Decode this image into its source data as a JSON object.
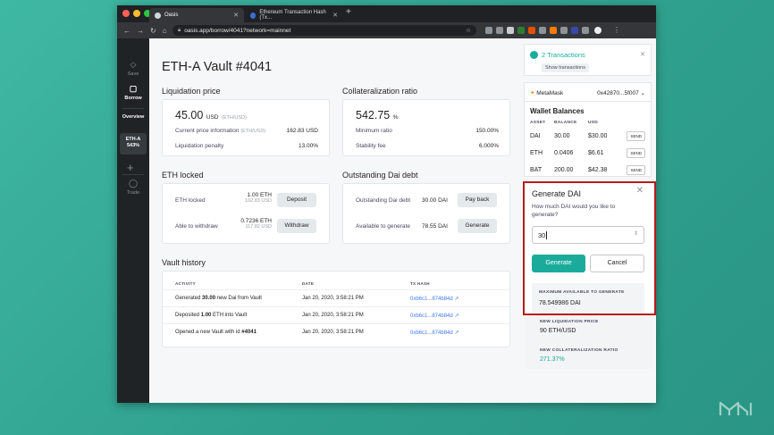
{
  "browser": {
    "tabs": [
      {
        "title": "Oasis",
        "active": true
      },
      {
        "title": "Ethereum Transaction Hash (Tx..."
      }
    ],
    "url": "oasis.app/borrow/4041?network=mainnet"
  },
  "sidebar": {
    "save": "Save",
    "borrow": "Borrow",
    "overview": "Overview",
    "vault_name": "ETH-A",
    "vault_ratio": "543%",
    "trade": "Trade"
  },
  "vault": {
    "title": "ETH-A Vault #4041",
    "liquidation": {
      "heading": "Liquidation price",
      "value": "45.00",
      "unit": "USD",
      "pair": "(ETH/USD)",
      "current_label": "Current price information",
      "current_pair": "(ETH/USD)",
      "current_value": "162.83 USD",
      "penalty_label": "Liquidation penalty",
      "penalty_value": "13.00%"
    },
    "collateral": {
      "heading": "Collateralization ratio",
      "value": "542.75",
      "unit": "%",
      "min_label": "Minimum ratio",
      "min_value": "150.00%",
      "fee_label": "Stability fee",
      "fee_value": "6.000%"
    },
    "eth_locked": {
      "heading": "ETH locked",
      "locked_label": "ETH locked",
      "locked_value": "1.00 ETH",
      "locked_usd": "162.83 USD",
      "deposit_label": "Deposit",
      "withdraw_label_row": "Able to withdraw",
      "withdraw_value": "0.7236 ETH",
      "withdraw_usd": "117.82 USD",
      "withdraw_button": "Withdraw"
    },
    "dai_debt": {
      "heading": "Outstanding Dai debt",
      "debt_label": "Outstanding Dai debt",
      "debt_value": "30.00 DAI",
      "payback_label": "Pay back",
      "available_label": "Available to generate",
      "available_value": "78.55 DAI",
      "generate_button": "Generate"
    },
    "history": {
      "heading": "Vault history",
      "columns": [
        "ACTIVITY",
        "DATE",
        "TX HASH"
      ],
      "rows": [
        {
          "pre": "Generated ",
          "bold": "30.00",
          "post": " new Dai from Vault",
          "date": "Jan 20, 2020, 3:58:21 PM",
          "hash": "0xb6c1...874b84d ↗"
        },
        {
          "pre": "Deposited ",
          "bold": "1.00",
          "post": " ETH into Vault",
          "date": "Jan 20, 2020, 3:58:21 PM",
          "hash": "0xb6c1...874b84d ↗"
        },
        {
          "pre": "Opened a new Vault with id ",
          "bold": "#4041",
          "post": "",
          "date": "Jan 20, 2020, 3:58:21 PM",
          "hash": "0xb6c1...874b84d ↗"
        }
      ]
    }
  },
  "right": {
    "transactions_title": "2 Transactions",
    "show_transactions": "Show transactions",
    "wallet_name": "MetaMask",
    "wallet_address": "0x42870...5f007",
    "balances_title": "Wallet Balances",
    "balance_columns": [
      "ASSET",
      "BALANCE",
      "USD"
    ],
    "balances": [
      {
        "asset": "DAI",
        "balance": "30.00",
        "usd": "$30.00",
        "action": "SEND"
      },
      {
        "asset": "ETH",
        "balance": "0.0406",
        "usd": "$6.61",
        "action": "SEND"
      },
      {
        "asset": "BAT",
        "balance": "200.00",
        "usd": "$42.38",
        "action": "SEND"
      }
    ]
  },
  "generate": {
    "title": "Generate DAI",
    "question": "How much DAI would you like to generate?",
    "input_value": "30",
    "generate_button": "Generate",
    "cancel_button": "Cancel",
    "max_caption": "MAXIMUM AVAILABLE TO GENERATE",
    "max_value": "78.549986 DAI",
    "liq_caption": "NEW LIQUIDATION PRICE",
    "liq_value": "90 ETH/USD",
    "coll_caption": "NEW COLLATERALIZATION RATIO",
    "coll_value": "271.37%"
  },
  "colors": {
    "background": "#35ad99",
    "accent": "#1aab9b",
    "highlight": "#b71c1c",
    "link": "#447afb"
  }
}
